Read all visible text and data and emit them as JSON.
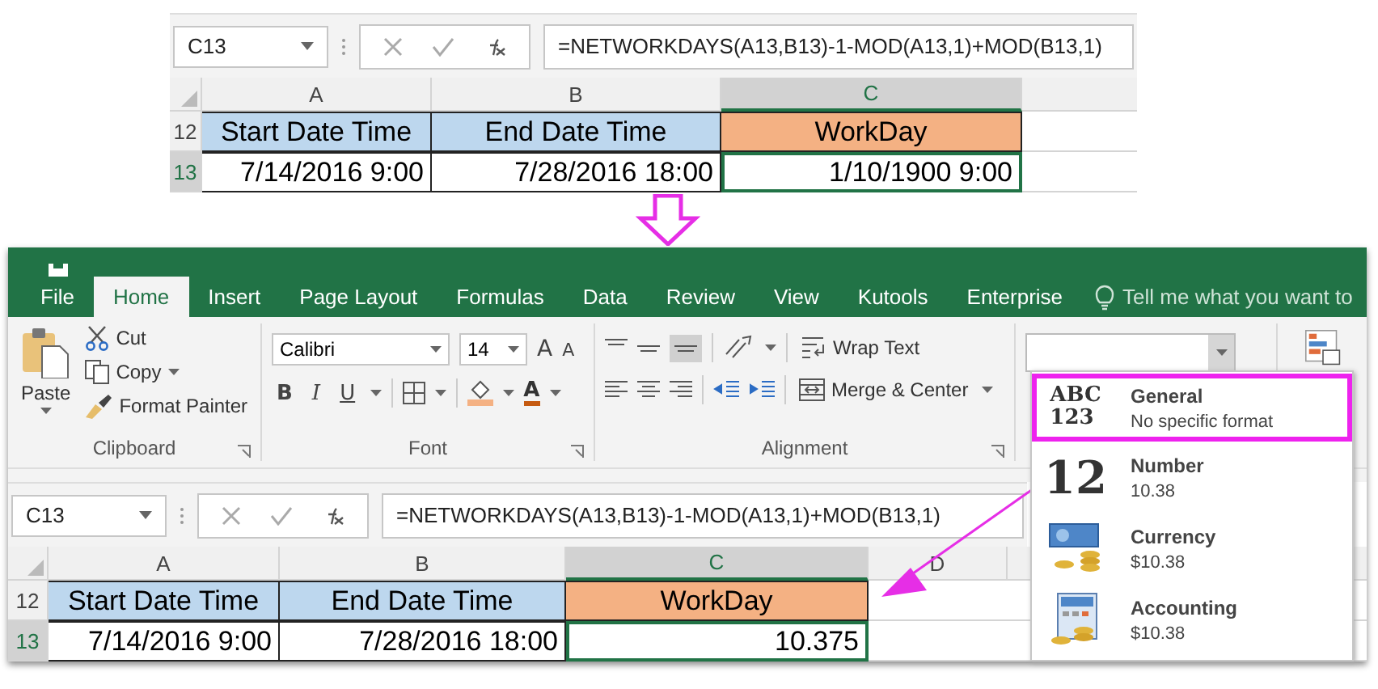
{
  "top_sheet": {
    "name_box": "C13",
    "formula": "=NETWORKDAYS(A13,B13)-1-MOD(A13,1)+MOD(B13,1)",
    "columns": [
      {
        "label": "A",
        "selected": false
      },
      {
        "label": "B",
        "selected": false
      },
      {
        "label": "C",
        "selected": true
      }
    ],
    "rows": [
      {
        "number": "12",
        "kind": "header",
        "selected": false,
        "cells": [
          {
            "text": "Start Date Time",
            "color": "#bdd7ee",
            "selected": false
          },
          {
            "text": "End Date Time",
            "color": "#bdd7ee",
            "selected": false
          },
          {
            "text": "WorkDay",
            "color": "#f4b183",
            "selected": false
          }
        ]
      },
      {
        "number": "13",
        "kind": "data",
        "selected": true,
        "cells": [
          {
            "text": "7/14/2016 9:00",
            "color": "#ffffff",
            "selected": false
          },
          {
            "text": "7/28/2016 18:00",
            "color": "#ffffff",
            "selected": false
          },
          {
            "text": "1/10/1900 9:00",
            "color": "#ffffff",
            "selected": true
          }
        ]
      }
    ]
  },
  "ribbon": {
    "tabs": [
      {
        "label": "File",
        "selected": false
      },
      {
        "label": "Home",
        "selected": true
      },
      {
        "label": "Insert",
        "selected": false
      },
      {
        "label": "Page Layout",
        "selected": false
      },
      {
        "label": "Formulas",
        "selected": false
      },
      {
        "label": "Data",
        "selected": false
      },
      {
        "label": "Review",
        "selected": false
      },
      {
        "label": "View",
        "selected": false
      },
      {
        "label": "Kutools",
        "selected": false
      },
      {
        "label": "Enterprise",
        "selected": false
      }
    ],
    "tell_me": "Tell me what you want to",
    "clipboard": {
      "paste": "Paste",
      "cut": "Cut",
      "copy": "Copy",
      "format_painter": "Format Painter",
      "label": "Clipboard"
    },
    "font": {
      "name": "Calibri",
      "size": "14",
      "grow": "A",
      "shrink": "A",
      "buttons": [
        {
          "kind": "bold",
          "label": "B"
        },
        {
          "kind": "italic",
          "label": "I"
        },
        {
          "kind": "underline",
          "label": "U"
        }
      ],
      "font_color": "A",
      "label": "Font"
    },
    "alignment": {
      "wrap_text": "Wrap Text",
      "merge_center": "Merge & Center",
      "label": "Alignment"
    }
  },
  "number_format_list": [
    {
      "kind": "general",
      "icon_text": [
        "ABC",
        "123"
      ],
      "name": "General",
      "example": "No specific format",
      "selected": true
    },
    {
      "kind": "number",
      "icon_text": [
        "12"
      ],
      "name": "Number",
      "example": "10.38",
      "selected": false
    },
    {
      "kind": "currency",
      "name": "Currency",
      "example": "$10.38",
      "selected": false
    },
    {
      "kind": "accounting",
      "name": "Accounting",
      "example": "$10.38",
      "selected": false
    }
  ],
  "bottom_sheet": {
    "name_box": "C13",
    "formula": "=NETWORKDAYS(A13,B13)-1-MOD(A13,1)+MOD(B13,1)",
    "columns": [
      {
        "label": "A",
        "selected": false
      },
      {
        "label": "B",
        "selected": false
      },
      {
        "label": "C",
        "selected": true
      },
      {
        "label": "D",
        "selected": false
      }
    ],
    "rows": [
      {
        "number": "12",
        "kind": "header",
        "selected": false,
        "cells": [
          {
            "text": "Start Date Time",
            "color": "#bdd7ee",
            "selected": false
          },
          {
            "text": "End Date Time",
            "color": "#bdd7ee",
            "selected": false
          },
          {
            "text": "WorkDay",
            "color": "#f4b183",
            "selected": false
          }
        ]
      },
      {
        "number": "13",
        "kind": "data",
        "selected": true,
        "cells": [
          {
            "text": "7/14/2016 9:00",
            "color": "#ffffff",
            "selected": false
          },
          {
            "text": "7/28/2016 18:00",
            "color": "#ffffff",
            "selected": false
          },
          {
            "text": "10.375",
            "color": "#ffffff",
            "selected": true
          }
        ]
      }
    ]
  }
}
